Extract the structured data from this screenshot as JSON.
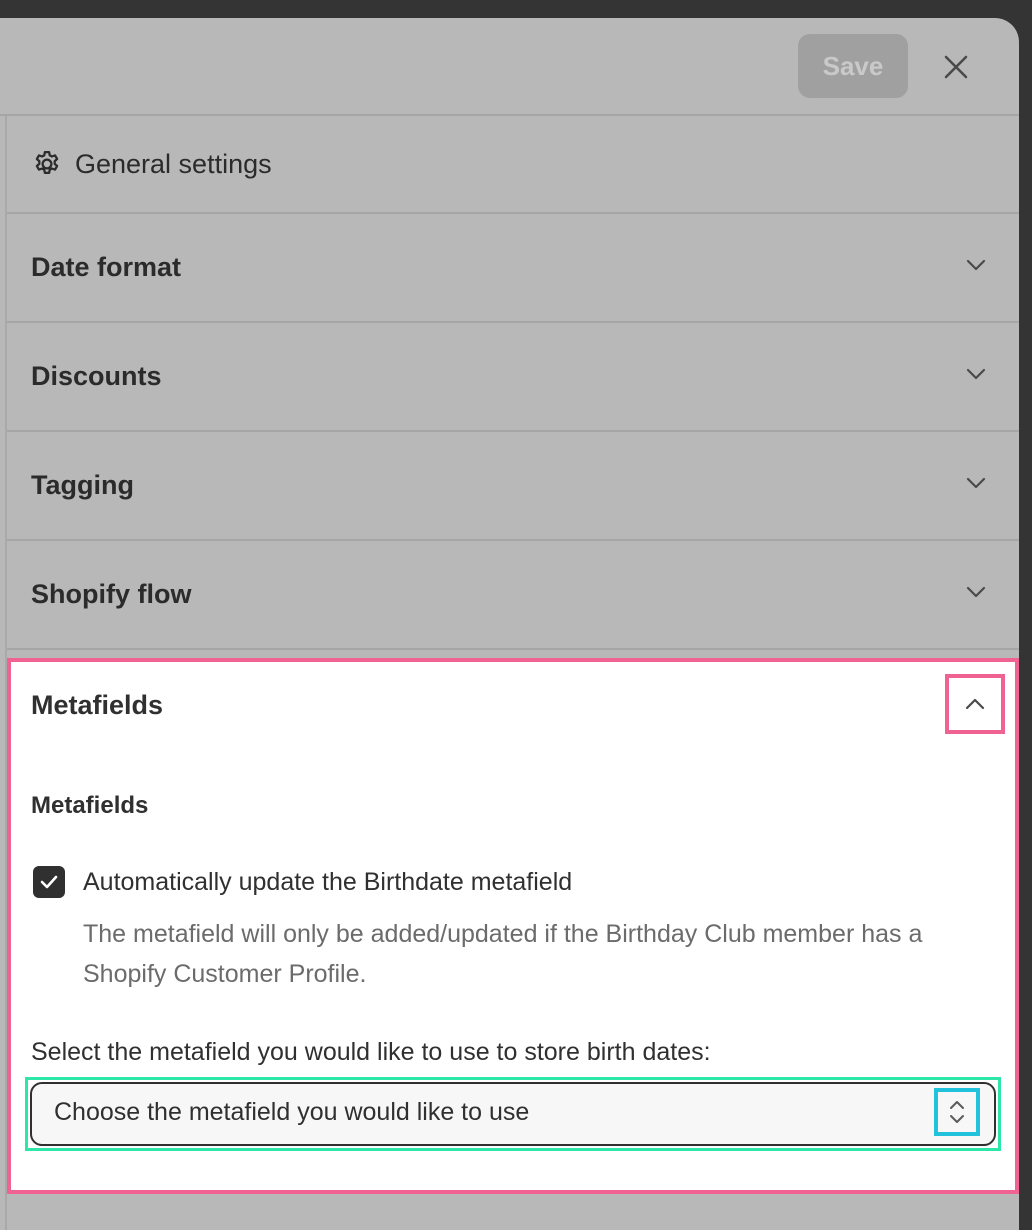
{
  "header": {
    "save_label": "Save",
    "close_icon": "close-icon"
  },
  "general": {
    "label": "General settings",
    "icon": "gear-icon"
  },
  "accordions": [
    {
      "label": "Date format",
      "expanded": false
    },
    {
      "label": "Discounts",
      "expanded": false
    },
    {
      "label": "Tagging",
      "expanded": false
    },
    {
      "label": "Shopify flow",
      "expanded": false
    }
  ],
  "metafields": {
    "title": "Metafields",
    "expanded": true,
    "section_title": "Metafields",
    "checkbox_label": "Automatically update the Birthdate metafield",
    "checkbox_checked": true,
    "help_text": "The metafield will only be added/updated if the Birthday Club member has a Shopify Customer Profile.",
    "select_label": "Select the metafield you would like to use to store birth dates:",
    "select_value": "Choose the metafield you would like to use"
  },
  "colors": {
    "highlight_pink": "#f06292",
    "highlight_green": "#2ee6a8",
    "highlight_cyan": "#22c1dc",
    "overlay_gray": "#b8b8b8"
  }
}
